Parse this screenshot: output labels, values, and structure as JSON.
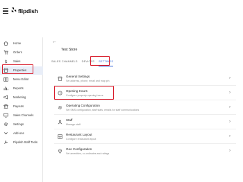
{
  "app": {
    "brand_name": "flipdish",
    "menu_icon": "hamburger-icon",
    "brand_icon": "flipdish-logo-icon"
  },
  "colors": {
    "accent": "#2c5fd6",
    "highlight": "#d81b2a",
    "active_nav_bg": "#e9eef8",
    "text": "#222222",
    "subtext": "#888888"
  },
  "sidebar": {
    "items": [
      {
        "label": "Home",
        "icon": "home-icon"
      },
      {
        "label": "Orders",
        "icon": "cart-icon"
      },
      {
        "label": "Sales",
        "icon": "dollar-icon"
      },
      {
        "label": "Properties",
        "icon": "store-icon",
        "active": true
      },
      {
        "label": "Menu Editor",
        "icon": "menu-book-icon"
      },
      {
        "label": "Reports",
        "icon": "chart-icon"
      },
      {
        "label": "Marketing",
        "icon": "megaphone-icon"
      },
      {
        "label": "Payouts",
        "icon": "bank-icon"
      },
      {
        "label": "Sales Channels",
        "icon": "channels-icon"
      },
      {
        "label": "Settings",
        "icon": "gear-icon"
      },
      {
        "label": "Add-ons",
        "icon": "chevron-down-icon"
      },
      {
        "label": "Flipdish Staff Tools",
        "icon": "tools-icon"
      }
    ]
  },
  "main": {
    "store_name": "Test Store",
    "tabs": [
      {
        "label": "SALES CHANNELS",
        "active": false
      },
      {
        "label": "DEVICES",
        "active": false
      },
      {
        "label": "SETTINGS",
        "active": true
      }
    ],
    "settings": [
      {
        "title": "General Settings",
        "subtitle": "Set address, phone, email and map pin",
        "icon": "store-icon"
      },
      {
        "title": "Opening Hours",
        "subtitle": "Configure property opening hours",
        "icon": "clock-icon"
      },
      {
        "title": "Operating Configuration",
        "subtitle": "Set SMS configuration, staff stats, emails for staff communications",
        "icon": "gear-icon"
      },
      {
        "title": "Staff",
        "subtitle": "Manage staff",
        "icon": "people-icon"
      },
      {
        "title": "Restaurant Layout",
        "subtitle": "Configure restaurant layout",
        "icon": "layout-icon"
      },
      {
        "title": "Geo Configuration",
        "subtitle": "Set amenities, co-ordinates and ratings",
        "icon": "location-icon"
      }
    ]
  }
}
